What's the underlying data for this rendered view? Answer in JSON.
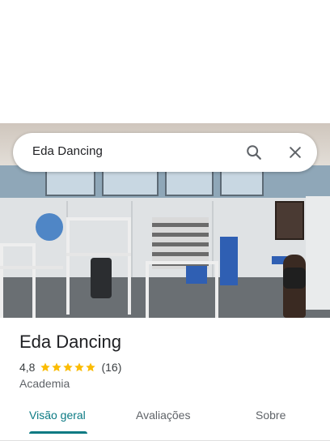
{
  "search": {
    "query": "Eda Dancing",
    "search_icon": "search-icon",
    "close_icon": "close-icon"
  },
  "place": {
    "name": "Eda Dancing",
    "rating": "4,8",
    "stars_shown": 5,
    "review_count": "(16)",
    "category": "Academia"
  },
  "tabs": [
    {
      "label": "Visão geral",
      "active": true
    },
    {
      "label": "Avaliações",
      "active": false
    },
    {
      "label": "Sobre",
      "active": false
    }
  ],
  "colors": {
    "accent": "#0b7a83",
    "star": "#fbbc04",
    "text_primary": "#202124",
    "text_secondary": "#5f6368"
  }
}
